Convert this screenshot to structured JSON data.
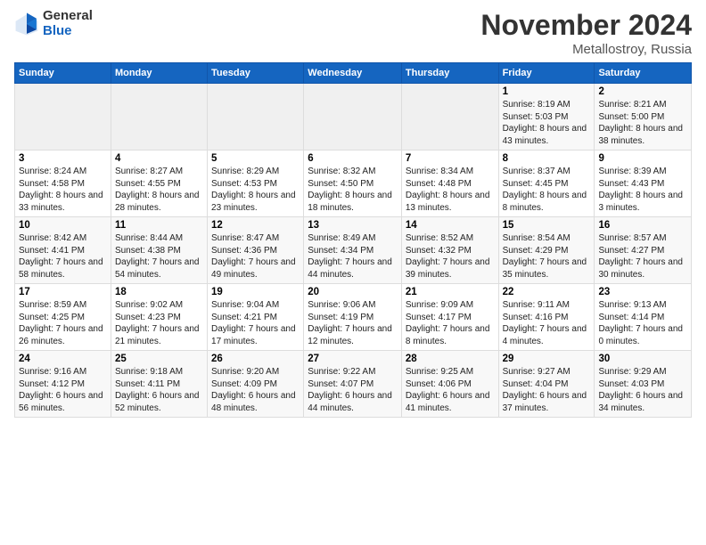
{
  "header": {
    "logo_general": "General",
    "logo_blue": "Blue",
    "title": "November 2024",
    "subtitle": "Metallostroy, Russia"
  },
  "columns": [
    "Sunday",
    "Monday",
    "Tuesday",
    "Wednesday",
    "Thursday",
    "Friday",
    "Saturday"
  ],
  "weeks": [
    [
      {
        "day": "",
        "detail": ""
      },
      {
        "day": "",
        "detail": ""
      },
      {
        "day": "",
        "detail": ""
      },
      {
        "day": "",
        "detail": ""
      },
      {
        "day": "",
        "detail": ""
      },
      {
        "day": "1",
        "detail": "Sunrise: 8:19 AM\nSunset: 5:03 PM\nDaylight: 8 hours and 43 minutes."
      },
      {
        "day": "2",
        "detail": "Sunrise: 8:21 AM\nSunset: 5:00 PM\nDaylight: 8 hours and 38 minutes."
      }
    ],
    [
      {
        "day": "3",
        "detail": "Sunrise: 8:24 AM\nSunset: 4:58 PM\nDaylight: 8 hours and 33 minutes."
      },
      {
        "day": "4",
        "detail": "Sunrise: 8:27 AM\nSunset: 4:55 PM\nDaylight: 8 hours and 28 minutes."
      },
      {
        "day": "5",
        "detail": "Sunrise: 8:29 AM\nSunset: 4:53 PM\nDaylight: 8 hours and 23 minutes."
      },
      {
        "day": "6",
        "detail": "Sunrise: 8:32 AM\nSunset: 4:50 PM\nDaylight: 8 hours and 18 minutes."
      },
      {
        "day": "7",
        "detail": "Sunrise: 8:34 AM\nSunset: 4:48 PM\nDaylight: 8 hours and 13 minutes."
      },
      {
        "day": "8",
        "detail": "Sunrise: 8:37 AM\nSunset: 4:45 PM\nDaylight: 8 hours and 8 minutes."
      },
      {
        "day": "9",
        "detail": "Sunrise: 8:39 AM\nSunset: 4:43 PM\nDaylight: 8 hours and 3 minutes."
      }
    ],
    [
      {
        "day": "10",
        "detail": "Sunrise: 8:42 AM\nSunset: 4:41 PM\nDaylight: 7 hours and 58 minutes."
      },
      {
        "day": "11",
        "detail": "Sunrise: 8:44 AM\nSunset: 4:38 PM\nDaylight: 7 hours and 54 minutes."
      },
      {
        "day": "12",
        "detail": "Sunrise: 8:47 AM\nSunset: 4:36 PM\nDaylight: 7 hours and 49 minutes."
      },
      {
        "day": "13",
        "detail": "Sunrise: 8:49 AM\nSunset: 4:34 PM\nDaylight: 7 hours and 44 minutes."
      },
      {
        "day": "14",
        "detail": "Sunrise: 8:52 AM\nSunset: 4:32 PM\nDaylight: 7 hours and 39 minutes."
      },
      {
        "day": "15",
        "detail": "Sunrise: 8:54 AM\nSunset: 4:29 PM\nDaylight: 7 hours and 35 minutes."
      },
      {
        "day": "16",
        "detail": "Sunrise: 8:57 AM\nSunset: 4:27 PM\nDaylight: 7 hours and 30 minutes."
      }
    ],
    [
      {
        "day": "17",
        "detail": "Sunrise: 8:59 AM\nSunset: 4:25 PM\nDaylight: 7 hours and 26 minutes."
      },
      {
        "day": "18",
        "detail": "Sunrise: 9:02 AM\nSunset: 4:23 PM\nDaylight: 7 hours and 21 minutes."
      },
      {
        "day": "19",
        "detail": "Sunrise: 9:04 AM\nSunset: 4:21 PM\nDaylight: 7 hours and 17 minutes."
      },
      {
        "day": "20",
        "detail": "Sunrise: 9:06 AM\nSunset: 4:19 PM\nDaylight: 7 hours and 12 minutes."
      },
      {
        "day": "21",
        "detail": "Sunrise: 9:09 AM\nSunset: 4:17 PM\nDaylight: 7 hours and 8 minutes."
      },
      {
        "day": "22",
        "detail": "Sunrise: 9:11 AM\nSunset: 4:16 PM\nDaylight: 7 hours and 4 minutes."
      },
      {
        "day": "23",
        "detail": "Sunrise: 9:13 AM\nSunset: 4:14 PM\nDaylight: 7 hours and 0 minutes."
      }
    ],
    [
      {
        "day": "24",
        "detail": "Sunrise: 9:16 AM\nSunset: 4:12 PM\nDaylight: 6 hours and 56 minutes."
      },
      {
        "day": "25",
        "detail": "Sunrise: 9:18 AM\nSunset: 4:11 PM\nDaylight: 6 hours and 52 minutes."
      },
      {
        "day": "26",
        "detail": "Sunrise: 9:20 AM\nSunset: 4:09 PM\nDaylight: 6 hours and 48 minutes."
      },
      {
        "day": "27",
        "detail": "Sunrise: 9:22 AM\nSunset: 4:07 PM\nDaylight: 6 hours and 44 minutes."
      },
      {
        "day": "28",
        "detail": "Sunrise: 9:25 AM\nSunset: 4:06 PM\nDaylight: 6 hours and 41 minutes."
      },
      {
        "day": "29",
        "detail": "Sunrise: 9:27 AM\nSunset: 4:04 PM\nDaylight: 6 hours and 37 minutes."
      },
      {
        "day": "30",
        "detail": "Sunrise: 9:29 AM\nSunset: 4:03 PM\nDaylight: 6 hours and 34 minutes."
      }
    ]
  ]
}
